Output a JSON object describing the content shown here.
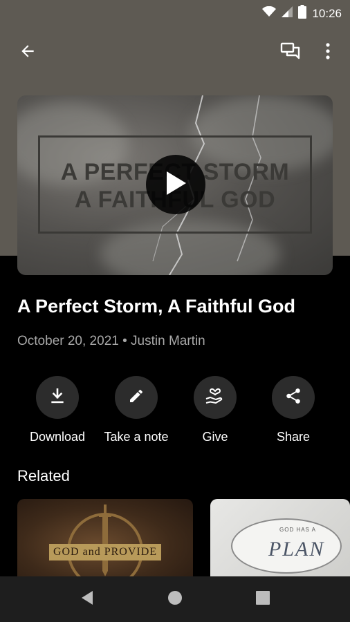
{
  "status_bar": {
    "time": "10:26",
    "icons": [
      "wifi-icon",
      "cell-signal-icon",
      "battery-icon"
    ]
  },
  "app_bar": {
    "icons": [
      "back-arrow-icon",
      "chat-icon",
      "more-vert-icon"
    ]
  },
  "hero": {
    "artwork_line1": "A PERFECT STORM",
    "artwork_line2": "A FAITHFUL GOD",
    "play_icon": "play-icon"
  },
  "sermon": {
    "title": "A Perfect Storm, A Faithful God",
    "meta": "October 20, 2021 • Justin Martin"
  },
  "actions": [
    {
      "label": "Download",
      "icon": "download-icon"
    },
    {
      "label": "Take a note",
      "icon": "pencil-icon"
    },
    {
      "label": "Give",
      "icon": "give-heart-icon"
    },
    {
      "label": "Share",
      "icon": "share-icon"
    }
  ],
  "related": {
    "title": "Related",
    "cards": [
      {
        "artwork_text": "GOD and PROVIDE"
      },
      {
        "artwork_small": "GOD HAS A",
        "artwork_text": "PLAN"
      }
    ]
  },
  "nav_bar": {
    "icons": [
      "nav-back-icon",
      "nav-home-icon",
      "nav-recents-icon"
    ]
  },
  "colors": {
    "top_band": "#5e5a53",
    "background": "#000000",
    "action_circle": "#2c2c2c",
    "meta_text": "#a8a8a8",
    "nav_bar": "#1e1e1e"
  }
}
